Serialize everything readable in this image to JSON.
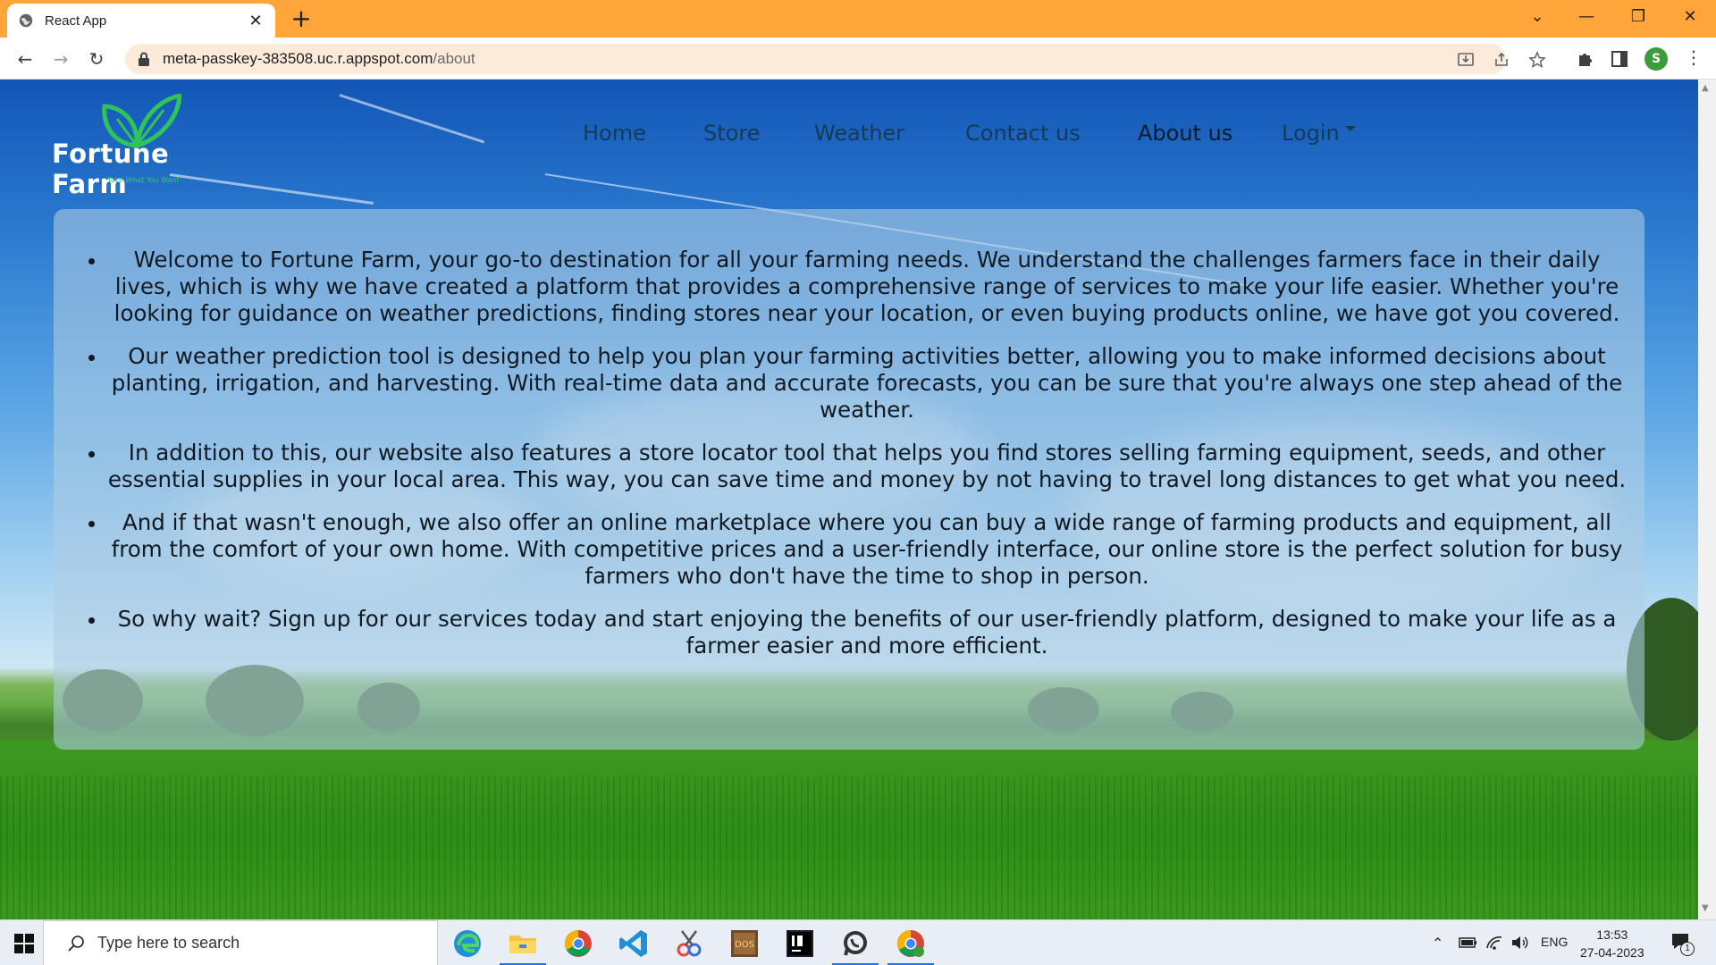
{
  "browser": {
    "tab_title": "React App",
    "new_tab": "+",
    "url_host": "meta-passkey-383508.uc.r.appspot.com",
    "url_path": "/about",
    "profile_initial": "S"
  },
  "site": {
    "logo_text": "Fortune Farm",
    "logo_tagline": "Take What You Want",
    "nav": {
      "home": "Home",
      "store": "Store",
      "weather": "Weather",
      "contact": "Contact us",
      "about": "About us",
      "login": "Login"
    },
    "about_paragraphs": [
      "Welcome to Fortune Farm, your go-to destination for all your farming needs. We understand the challenges farmers face in their daily lives, which is why we have created a platform that provides a comprehensive range of services to make your life easier. Whether you're looking for guidance on weather predictions, finding stores near your location, or even buying products online, we have got you covered.",
      "Our weather prediction tool is designed to help you plan your farming activities better, allowing you to make informed decisions about planting, irrigation, and harvesting. With real-time data and accurate forecasts, you can be sure that you're always one step ahead of the weather.",
      "In addition to this, our website also features a store locator tool that helps you find stores selling farming equipment, seeds, and other essential supplies in your local area. This way, you can save time and money by not having to travel long distances to get what you need.",
      "And if that wasn't enough, we also offer an online marketplace where you can buy a wide range of farming products and equipment, all from the comfort of your own home. With competitive prices and a user-friendly interface, our online store is the perfect solution for busy farmers who don't have the time to shop in person.",
      "So why wait? Sign up for our services today and start enjoying the benefits of our user-friendly platform, designed to make your life as a farmer easier and more efficient."
    ]
  },
  "taskbar": {
    "search_placeholder": "Type here to search",
    "language": "ENG",
    "time": "13:53",
    "date": "27-04-2023",
    "notification_count": "1"
  },
  "colors": {
    "chrome_accent": "#ffa53a",
    "logo_leaf": "#2fc45a",
    "nav_text": "#163a55"
  }
}
